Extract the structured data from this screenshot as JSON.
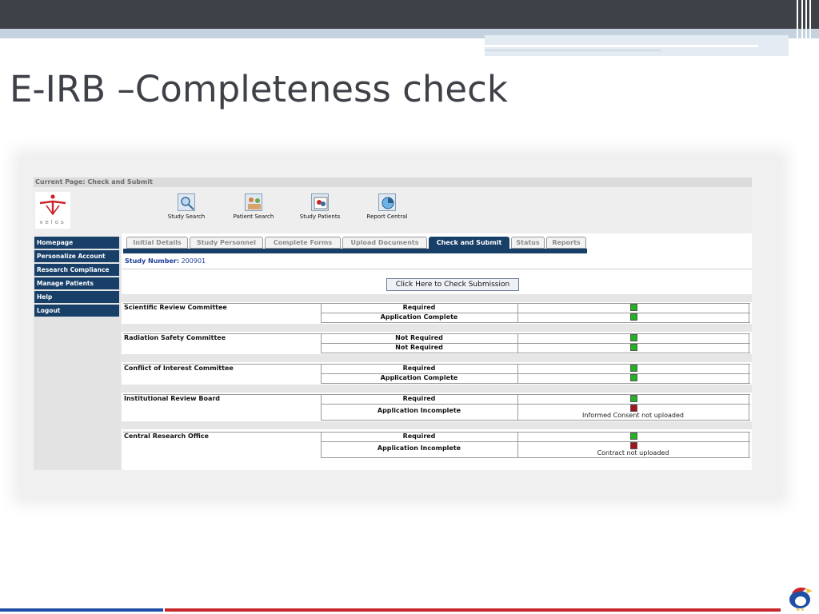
{
  "slide": {
    "title": "E-IRB –Completeness check"
  },
  "app": {
    "current_page": "Current Page: Check and Submit",
    "logo_text": "velos",
    "colors": {
      "nav": "#183f68",
      "ok": "#1fb51f",
      "missing": "#a5131b"
    },
    "toolbar": [
      {
        "label": "Study Search",
        "icon": "magnifier-icon"
      },
      {
        "label": "Patient Search",
        "icon": "patient-search-icon"
      },
      {
        "label": "Study Patients",
        "icon": "study-patients-icon"
      },
      {
        "label": "Report Central",
        "icon": "report-icon"
      }
    ],
    "sidebar": [
      "Homepage",
      "Personalize Account",
      "Research Compliance",
      "Manage Patients",
      "Help",
      "Logout"
    ],
    "tabs": [
      {
        "label": "Initial Details",
        "active": false
      },
      {
        "label": "Study Personnel",
        "active": false
      },
      {
        "label": "Complete Forms",
        "active": false
      },
      {
        "label": "Upload Documents",
        "active": false
      },
      {
        "label": "Check and Submit",
        "active": true
      },
      {
        "label": "Status",
        "active": false
      },
      {
        "label": "Reports",
        "active": false
      }
    ],
    "study_number_label": "Study Number:",
    "study_number": "200901",
    "check_button": "Click Here to Check Submission",
    "committees": [
      {
        "name": "Scientific Review Committee",
        "rows": [
          {
            "status": "Required",
            "ok": true,
            "note": ""
          },
          {
            "status": "Application Complete",
            "ok": true,
            "note": ""
          }
        ]
      },
      {
        "name": "Radiation Safety Committee",
        "rows": [
          {
            "status": "Not Required",
            "ok": true,
            "note": ""
          },
          {
            "status": "Not Required",
            "ok": true,
            "note": ""
          }
        ]
      },
      {
        "name": "Conflict of Interest Committee",
        "rows": [
          {
            "status": "Required",
            "ok": true,
            "note": ""
          },
          {
            "status": "Application Complete",
            "ok": true,
            "note": ""
          }
        ]
      },
      {
        "name": "Institutional Review Board",
        "rows": [
          {
            "status": "Required",
            "ok": true,
            "note": ""
          },
          {
            "status": "Application Incomplete",
            "ok": false,
            "note": "Informed Consent not uploaded"
          }
        ]
      },
      {
        "name": "Central Research Office",
        "rows": [
          {
            "status": "Required",
            "ok": true,
            "note": ""
          },
          {
            "status": "Application Incomplete",
            "ok": false,
            "note": "Contract not uploaded"
          }
        ]
      }
    ]
  }
}
